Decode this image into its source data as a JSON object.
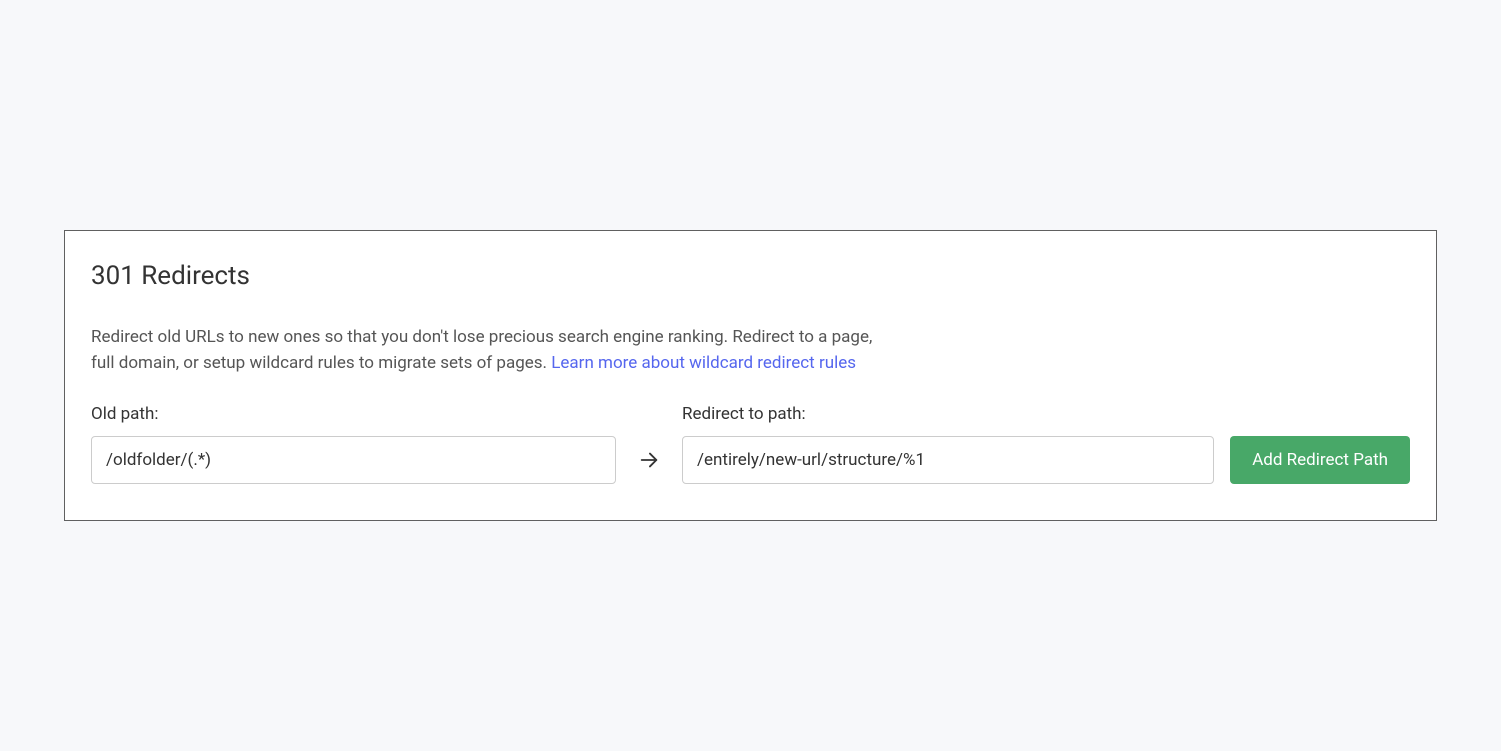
{
  "card": {
    "title": "301 Redirects",
    "description_text": "Redirect old URLs to new ones so that you don't lose precious search engine ranking. Redirect to a page, full domain, or setup wildcard rules to migrate sets of pages. ",
    "learn_more_label": "Learn more about wildcard redirect rules"
  },
  "form": {
    "old_path_label": "Old path:",
    "old_path_value": "/oldfolder/(.*)",
    "new_path_label": "Redirect to path:",
    "new_path_value": "/entirely/new-url/structure/%1",
    "button_label": "Add Redirect Path"
  }
}
